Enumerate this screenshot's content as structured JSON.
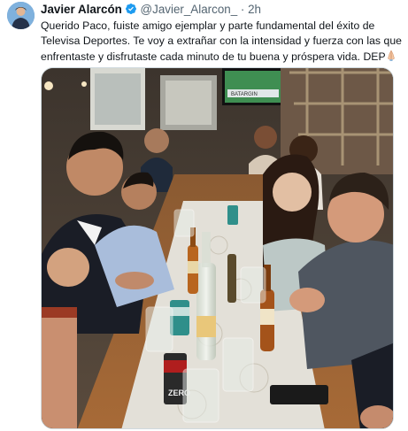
{
  "author": {
    "display_name": "Javier Alarcón",
    "handle": "@Javier_Alarcon_",
    "separator": "·",
    "time": "2h",
    "avatar_icon": "user-avatar",
    "verified_icon": "verified-badge-icon",
    "verified_color": "#1d9bf0"
  },
  "tweet": {
    "line1": "Querido Paco, fuiste amigo ejemplar y parte fundamental del éxito de",
    "line2": "Televisa Deportes. Te voy a extrañar con la intensidad y fuerza con las que",
    "line3": "enfrentaste y disfrutaste cada minuto de tu buena y próspera vida. DEP",
    "emoji_icon": "praying-hands-icon"
  },
  "media": {
    "icon": "group-dinner-photo",
    "tv_text": "BATARGIN",
    "can_text": "ZERO"
  }
}
